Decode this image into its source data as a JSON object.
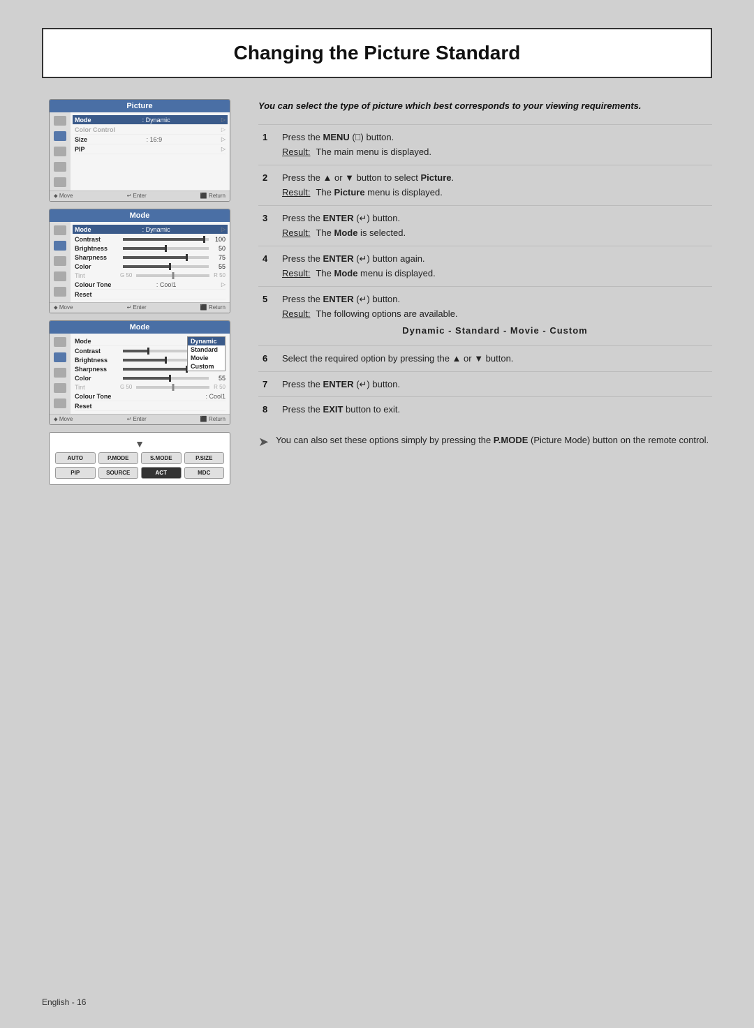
{
  "page": {
    "title": "Changing the Picture Standard",
    "background_color": "#d0d0d0"
  },
  "footer": {
    "text": "English - 16"
  },
  "intro": {
    "text": "You can select the type of picture which best corresponds to your viewing requirements."
  },
  "screens": {
    "screen1": {
      "header": "Picture",
      "mode_label": "Mode",
      "mode_value": ": Dynamic",
      "color_control": "Color Control",
      "size_label": "Size",
      "size_value": ": 16:9",
      "pip": "PIP",
      "footer_move": "Move",
      "footer_enter": "Enter",
      "footer_return": "Return"
    },
    "screen2": {
      "header": "Mode",
      "mode_label": "Mode",
      "mode_value": ": Dynamic",
      "contrast_label": "Contrast",
      "contrast_val": "100",
      "brightness_label": "Brightness",
      "brightness_val": "50",
      "sharpness_label": "Sharpness",
      "sharpness_val": "75",
      "color_label": "Color",
      "color_val": "55",
      "tint_label": "Tint",
      "tint_g": "G 50",
      "tint_r": "R 50",
      "colour_tone": "Colour Tone",
      "colour_tone_val": ": Cool1",
      "reset": "Reset",
      "footer_move": "Move",
      "footer_enter": "Enter",
      "footer_return": "Return"
    },
    "screen3": {
      "header": "Mode",
      "mode_label": "Mode",
      "contrast_label": "Contrast",
      "brightness_label": "Brightness",
      "sharpness_label": "Sharpness",
      "color_label": "Color",
      "tint_label": "Tint",
      "colour_tone": "Colour Tone",
      "colour_tone_val": ": Cool1",
      "reset": "Reset",
      "dropdown": {
        "dynamic": "Dynamic",
        "standard": "Standard",
        "movie": "Movie",
        "custom": "Custom"
      }
    }
  },
  "steps": [
    {
      "num": "1",
      "instruction": "Press the MENU (   ) button.",
      "result": "The main menu is displayed."
    },
    {
      "num": "2",
      "instruction": "Press the ▲ or ▼ button to select Picture.",
      "result": "The Picture menu is displayed."
    },
    {
      "num": "3",
      "instruction": "Press the ENTER (   ) button.",
      "result": "The Mode is selected."
    },
    {
      "num": "4",
      "instruction": "Press the ENTER (   ) button again.",
      "result": "The Mode menu is displayed."
    },
    {
      "num": "5",
      "instruction": "Press the ENTER (   ) button.",
      "result": "The following options are available.",
      "options": "Dynamic - Standard - Movie - Custom"
    },
    {
      "num": "6",
      "instruction": "Select the required option by pressing the ▲ or ▼ button."
    },
    {
      "num": "7",
      "instruction": "Press the ENTER (   ) button."
    },
    {
      "num": "8",
      "instruction": "Press the EXIT button to exit."
    }
  ],
  "note": {
    "text": "You can also set these options simply by pressing the P.MODE (Picture Mode) button on the remote control."
  },
  "remote": {
    "buttons_row1": [
      "AUTO",
      "P.MODE",
      "S.MODE",
      "P.SIZE"
    ],
    "buttons_row2": [
      "PIP",
      "SOURCE",
      "ACT",
      "MDC"
    ]
  }
}
